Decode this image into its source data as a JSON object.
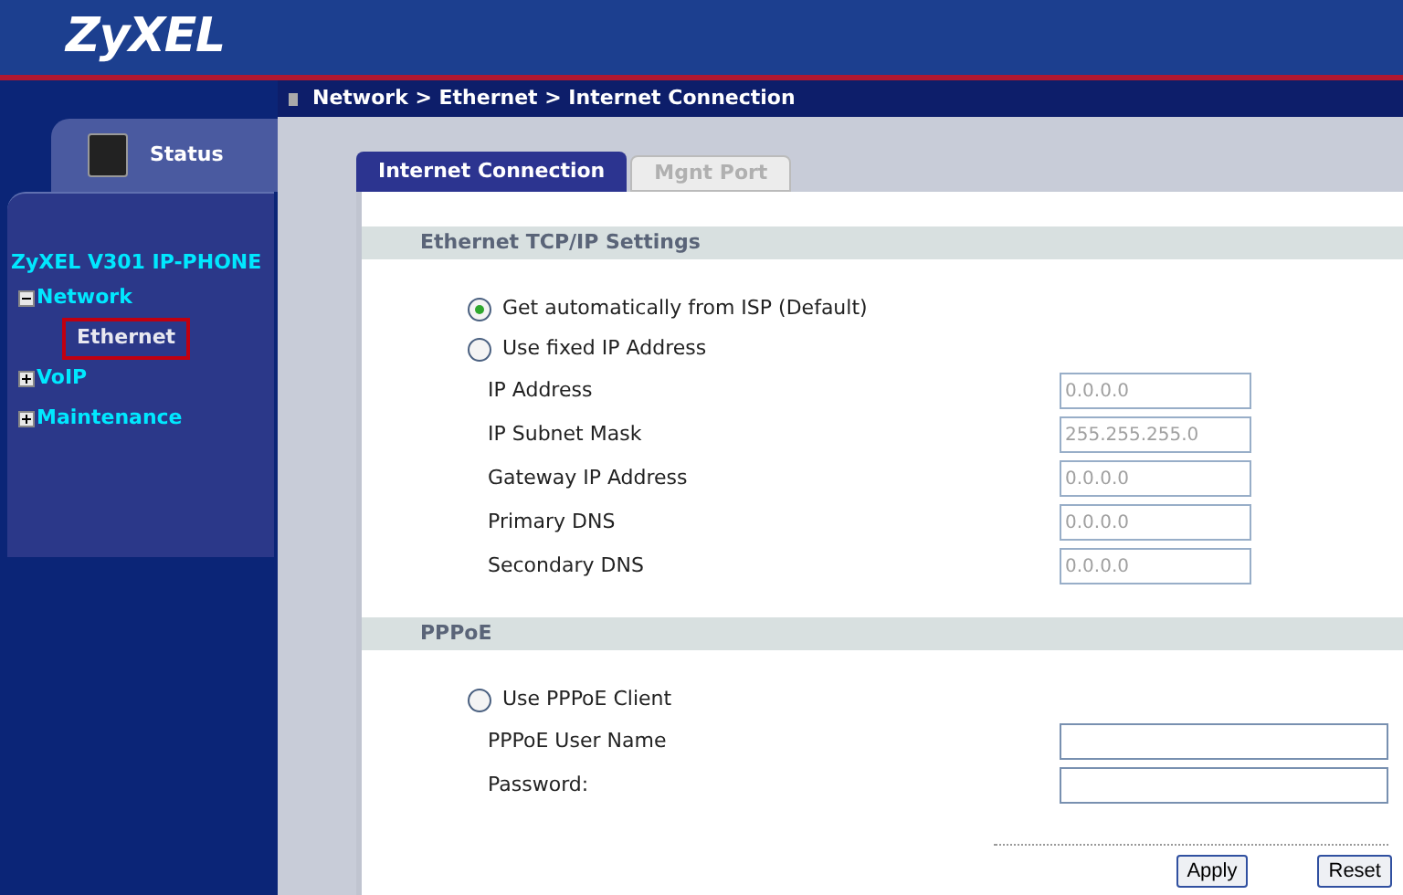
{
  "logo": "ZyXEL",
  "breadcrumb": "Network > Ethernet > Internet Connection",
  "status_tab": "Status",
  "tree": {
    "title": "ZyXEL V301 IP-PHONE",
    "items": [
      {
        "label": "Network",
        "expanded": true,
        "children": [
          {
            "label": "Ethernet",
            "selected": true
          }
        ]
      },
      {
        "label": "VoIP",
        "expanded": false
      },
      {
        "label": "Maintenance",
        "expanded": false
      }
    ]
  },
  "tabs": [
    {
      "label": "Internet Connection",
      "selected": true
    },
    {
      "label": "Mgnt Port",
      "selected": false
    }
  ],
  "sections": [
    {
      "title": "Ethernet TCP/IP Settings",
      "items": [
        {
          "kind": "radio",
          "label": "Get automatically from ISP (Default)",
          "selected": true
        },
        {
          "kind": "radio",
          "label": "Use fixed IP Address",
          "selected": false
        },
        {
          "kind": "field",
          "label": "IP Address",
          "value": "0.0.0.0",
          "disabled": true
        },
        {
          "kind": "field",
          "label": "IP Subnet Mask",
          "value": "255.255.255.0",
          "disabled": true
        },
        {
          "kind": "field",
          "label": "Gateway IP Address",
          "value": "0.0.0.0",
          "disabled": true
        },
        {
          "kind": "field",
          "label": "Primary DNS",
          "value": "0.0.0.0",
          "disabled": true
        },
        {
          "kind": "field",
          "label": "Secondary DNS",
          "value": "0.0.0.0",
          "disabled": true
        }
      ]
    },
    {
      "title": "PPPoE",
      "items": [
        {
          "kind": "radio",
          "label": "Use PPPoE Client",
          "selected": false
        },
        {
          "kind": "field",
          "label": "PPPoE User Name",
          "disabled": false,
          "wide": true
        },
        {
          "kind": "field",
          "label": "Password:",
          "disabled": false,
          "wide": true
        }
      ]
    }
  ],
  "buttons": [
    "Apply",
    "Reset"
  ]
}
